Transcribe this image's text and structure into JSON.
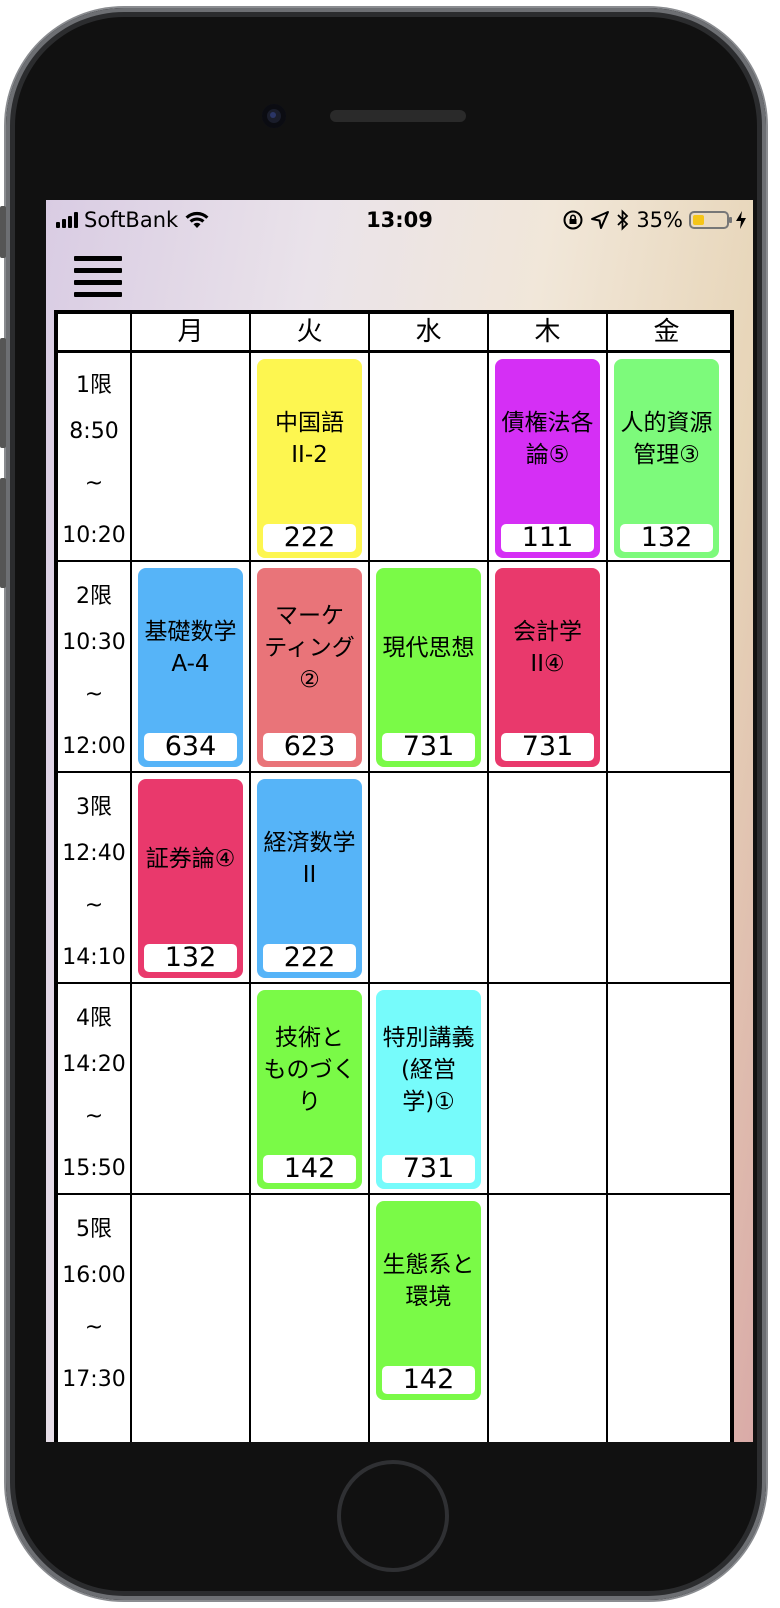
{
  "status_bar": {
    "carrier": "SoftBank",
    "time": "13:09",
    "battery_percent": "35%",
    "battery_level": 0.35,
    "icons": [
      "signal-icon",
      "wifi-icon",
      "rotation-lock-icon",
      "location-icon",
      "bluetooth-icon",
      "battery-icon",
      "charging-icon"
    ]
  },
  "menu": {
    "icon": "hamburger-menu-icon"
  },
  "days": [
    "月",
    "火",
    "水",
    "木",
    "金"
  ],
  "periods": [
    {
      "label": "1限",
      "start": "8:50",
      "sep": "~",
      "end": "10:20"
    },
    {
      "label": "2限",
      "start": "10:30",
      "sep": "~",
      "end": "12:00"
    },
    {
      "label": "3限",
      "start": "12:40",
      "sep": "~",
      "end": "14:10"
    },
    {
      "label": "4限",
      "start": "14:20",
      "sep": "~",
      "end": "15:50"
    },
    {
      "label": "5限",
      "start": "16:00",
      "sep": "~",
      "end": "17:30"
    }
  ],
  "courses": [
    {
      "day": 1,
      "period": 0,
      "name": "中国語\nII-2",
      "room": "222",
      "color": "#fdf650"
    },
    {
      "day": 3,
      "period": 0,
      "name": "債権法各\n論⑤",
      "room": "111",
      "color": "#d52ff5"
    },
    {
      "day": 4,
      "period": 0,
      "name": "人的資源\n管理③",
      "room": "132",
      "color": "#7dfa7b"
    },
    {
      "day": 0,
      "period": 1,
      "name": "基礎数学\nA-4",
      "room": "634",
      "color": "#56b4f8"
    },
    {
      "day": 1,
      "period": 1,
      "name": "マーケ\nティング\n②",
      "room": "623",
      "color": "#e97479"
    },
    {
      "day": 2,
      "period": 1,
      "name": "現代思想",
      "room": "731",
      "color": "#7afa47"
    },
    {
      "day": 3,
      "period": 1,
      "name": "会計学\nII④",
      "room": "731",
      "color": "#e9396c"
    },
    {
      "day": 0,
      "period": 2,
      "name": "証券論④",
      "room": "132",
      "color": "#e9396c"
    },
    {
      "day": 1,
      "period": 2,
      "name": "経済数学\nII",
      "room": "222",
      "color": "#56b4f8"
    },
    {
      "day": 1,
      "period": 3,
      "name": "技術と\nものづく\nり",
      "room": "142",
      "color": "#7afa47"
    },
    {
      "day": 2,
      "period": 3,
      "name": "特別講義\n(経営\n学)①",
      "room": "731",
      "color": "#76fbfb"
    },
    {
      "day": 2,
      "period": 4,
      "name": "生態系と\n環境",
      "room": "142",
      "color": "#7afa47"
    }
  ]
}
